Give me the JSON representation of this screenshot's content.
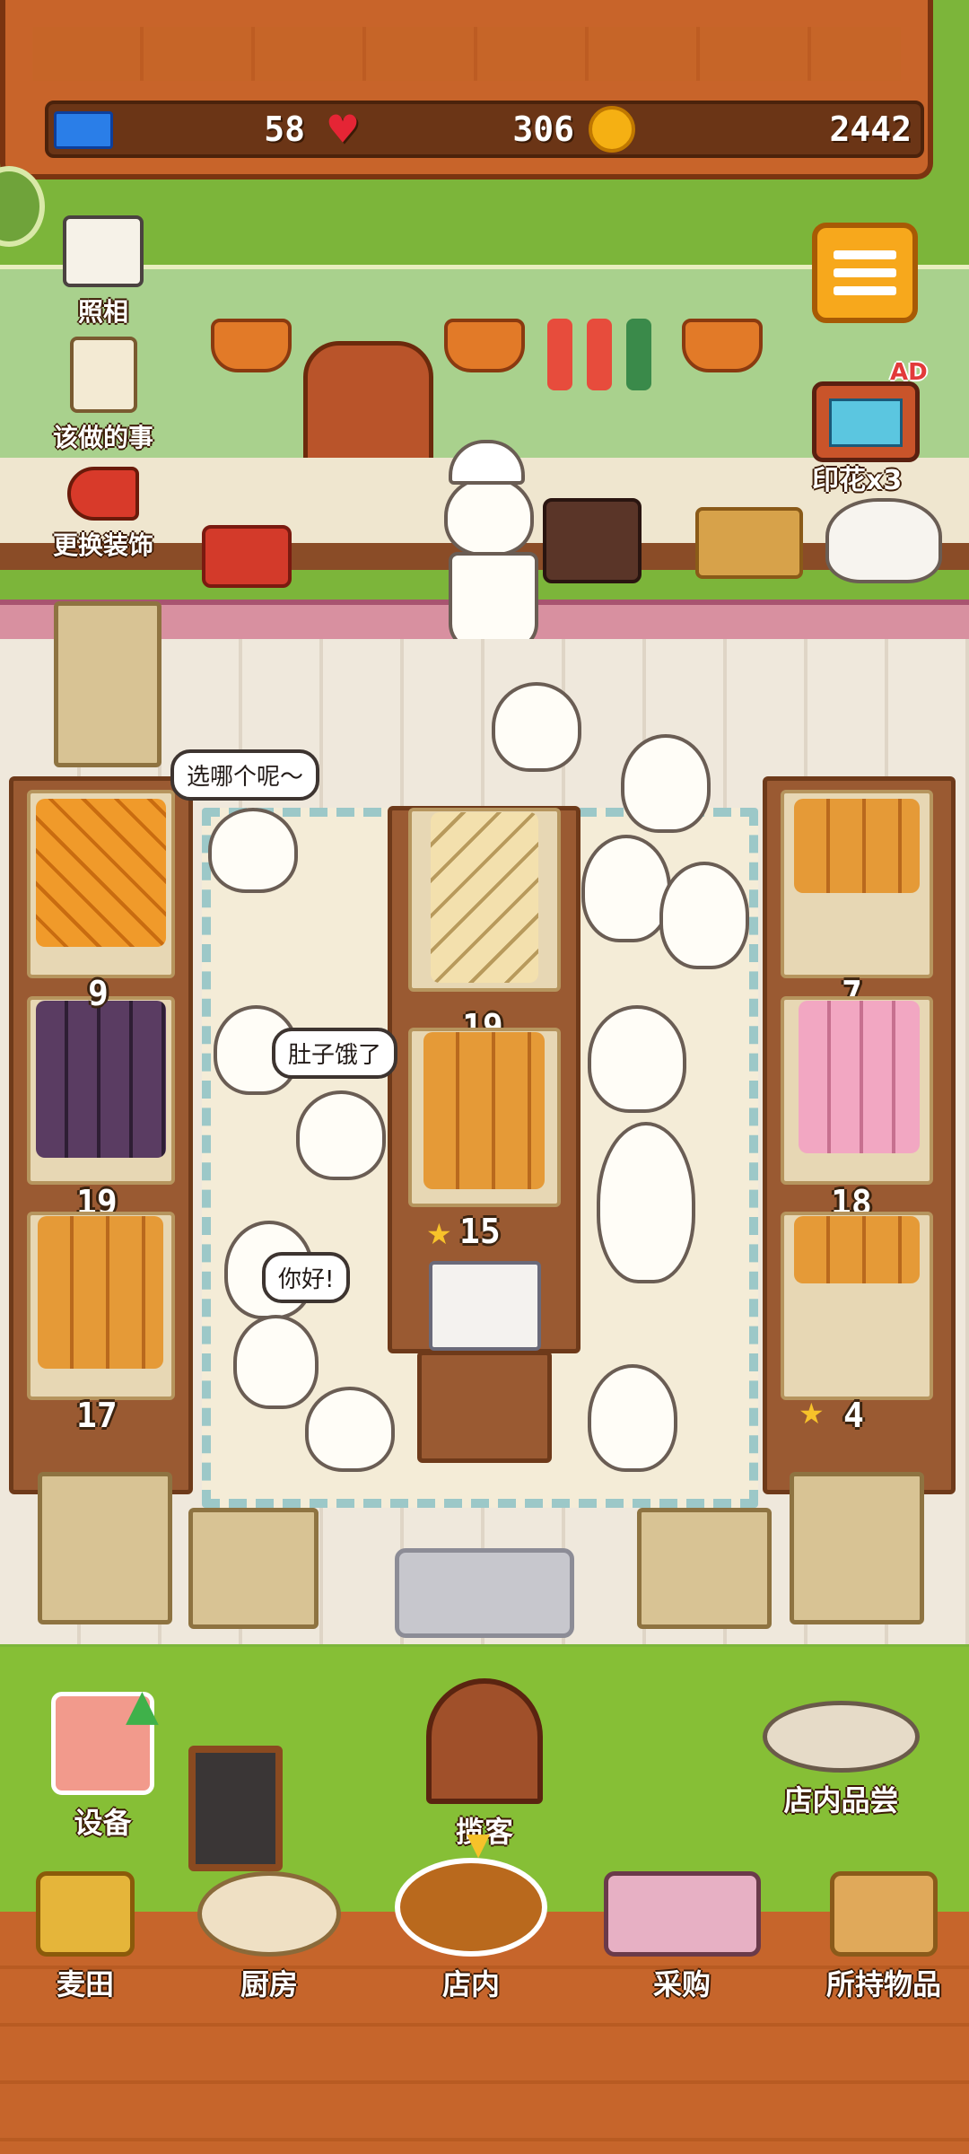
{
  "status": {
    "tickets": "58",
    "hearts": "306",
    "coins": "2442"
  },
  "left_menu": {
    "photo": "照相",
    "todo": "该做的事",
    "decor": "更换装饰"
  },
  "right_menu": {
    "stamp": "印花x3",
    "ad_badge": "AD"
  },
  "speech": {
    "choose": "选哪个呢～",
    "hungry": "肚子饿了",
    "hello": "你好!"
  },
  "shelf_counts": {
    "left_purple": "9",
    "left_bread_mid": "19",
    "left_bottom": "17",
    "center_buns": "19",
    "center_star": "15",
    "right_pink": "7",
    "right_bread": "18",
    "right_star": "4"
  },
  "bottom_actions": {
    "equipment": "设备",
    "attract": "揽客",
    "tasting": "店内品尝"
  },
  "bottom_nav": {
    "wheat_field": "麦田",
    "kitchen": "厨房",
    "shop": "店内",
    "purchase": "采购",
    "inventory": "所持物品"
  },
  "colors": {
    "wood": "#c8642a",
    "grass": "#86bf36",
    "menu_orange": "#f7a81c"
  }
}
